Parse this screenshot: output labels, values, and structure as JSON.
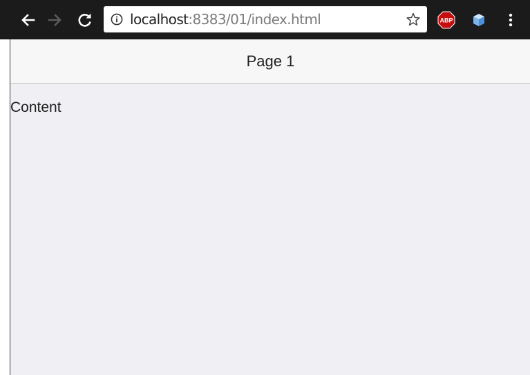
{
  "browser": {
    "url_host": "localhost",
    "url_path": ":8383/01/index.html",
    "icons": {
      "back": "back-arrow-icon",
      "forward": "forward-arrow-icon",
      "reload": "reload-icon",
      "info": "info-icon",
      "bookmark": "star-icon",
      "adblock": "abp-icon",
      "extension": "cube-icon",
      "menu": "kebab-menu-icon"
    },
    "adblock_label": "ABP",
    "colors": {
      "toolbar": "#1b1b1b",
      "adblock_red": "#c70d0d",
      "cube_blue": "#4a90d9"
    }
  },
  "page": {
    "title": "Page 1",
    "content": "Content",
    "colors": {
      "navbar_bg": "#f7f7f8",
      "content_bg": "#efeff4"
    }
  }
}
